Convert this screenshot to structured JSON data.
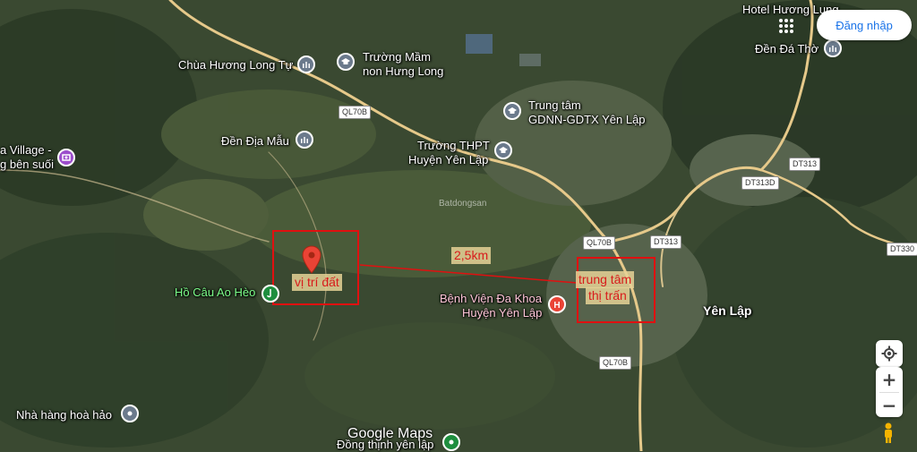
{
  "places": {
    "chua_huong_long_tu": "Chùa Hương Long Tự",
    "truong_mam_non_1": "Trường Mầm",
    "truong_mam_non_2": "non Hưng Long",
    "trung_tam_1": "Trung tâm",
    "trung_tam_2": "GDNN-GDTX Yên Lập",
    "den_dia_mau": "Đền Địa Mẫu",
    "truong_thpt_1": "Trường THPT",
    "truong_thpt_2": "Huyện Yên Lập",
    "village_1": "a Village -",
    "village_2": "g bên suối",
    "hotel": "Hotel Hương Lung",
    "den_da_tho": "Đền Đá Thờ",
    "ho_cau": "Hồ Câu Ao Hèo",
    "benh_vien_1": "Bệnh Viện Đa Khoa",
    "benh_vien_2": "Huyện Yên Lập",
    "yen_lap": "Yên Lập",
    "nha_hang": "Nhà hàng hoà hảo",
    "dong_thinh": "Đồng thịnh yên lập"
  },
  "roads": {
    "ql70b_1": "QL70B",
    "ql70b_2": "QL70B",
    "ql70b_3": "QL70B",
    "dt313_1": "DT313",
    "dt313_2": "DT313",
    "dt313d": "DT313D",
    "dt330": "DT330"
  },
  "annotations": {
    "vi_tri_dat": "vị trí đất",
    "distance": "2,5km",
    "trung_tam_1": "trung tâm",
    "trung_tam_2": "thị trấn"
  },
  "watermark": "Batdongsan",
  "controls": {
    "login_label": "Đăng nhập",
    "zoom_in": "+",
    "zoom_out": "−"
  },
  "attribution": "Google Maps",
  "icons": {
    "apps": "apps-grid-icon",
    "locate": "my-location-icon",
    "pegman": "pegman-icon",
    "pin": "location-pin-icon"
  },
  "colors": {
    "annotation_red": "#e01010",
    "poi_gray": "#6b7a8c",
    "poi_purple": "#9c4dcc",
    "poi_green": "#1e8e3e",
    "poi_red": "#ea4335",
    "link_blue": "#1a73e8"
  }
}
